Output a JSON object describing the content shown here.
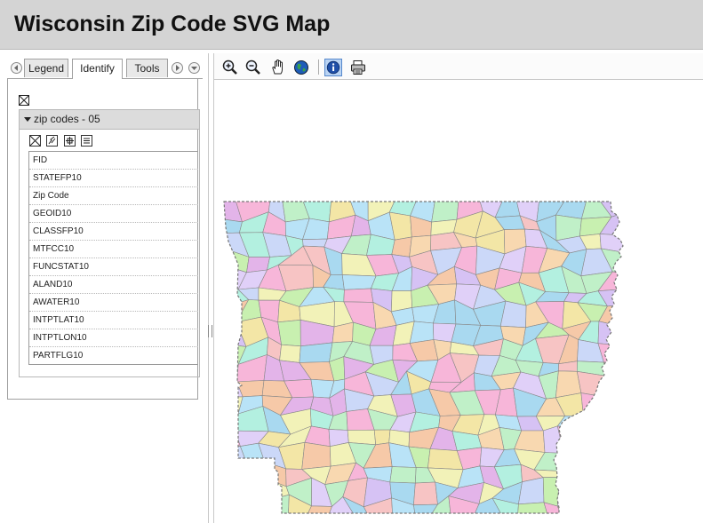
{
  "header": {
    "title": "Wisconsin Zip Code SVG Map"
  },
  "left_panel": {
    "tabs": [
      {
        "label": "Legend"
      },
      {
        "label": "Identify"
      },
      {
        "label": "Tools"
      }
    ],
    "layer_title": "zip codes - 05",
    "fields": [
      "FID",
      "STATEFP10",
      "Zip Code",
      "GEOID10",
      "CLASSFP10",
      "MTFCC10",
      "FUNCSTAT10",
      "ALAND10",
      "AWATER10",
      "INTPTLAT10",
      "INTPTLON10",
      "PARTFLG10"
    ]
  },
  "toolbar": {
    "tools": [
      "zoom-in-icon",
      "zoom-out-icon",
      "pan-hand-icon",
      "globe-full-extent-icon",
      "identify-info-icon",
      "print-icon"
    ],
    "active_tool": "identify-info-icon"
  },
  "map": {
    "fill_palette": [
      "#f7b6d9",
      "#b9e3f7",
      "#c8f0b0",
      "#f3e6a6",
      "#d6c2f4",
      "#f6c9a8",
      "#b3f0e0",
      "#e3b4e9",
      "#cbd8f8",
      "#f2f2b8",
      "#a9d9f0",
      "#f7c4c4",
      "#c0f0c8",
      "#e0d0f8",
      "#f8d8b0"
    ],
    "outline_color": "#888888"
  }
}
